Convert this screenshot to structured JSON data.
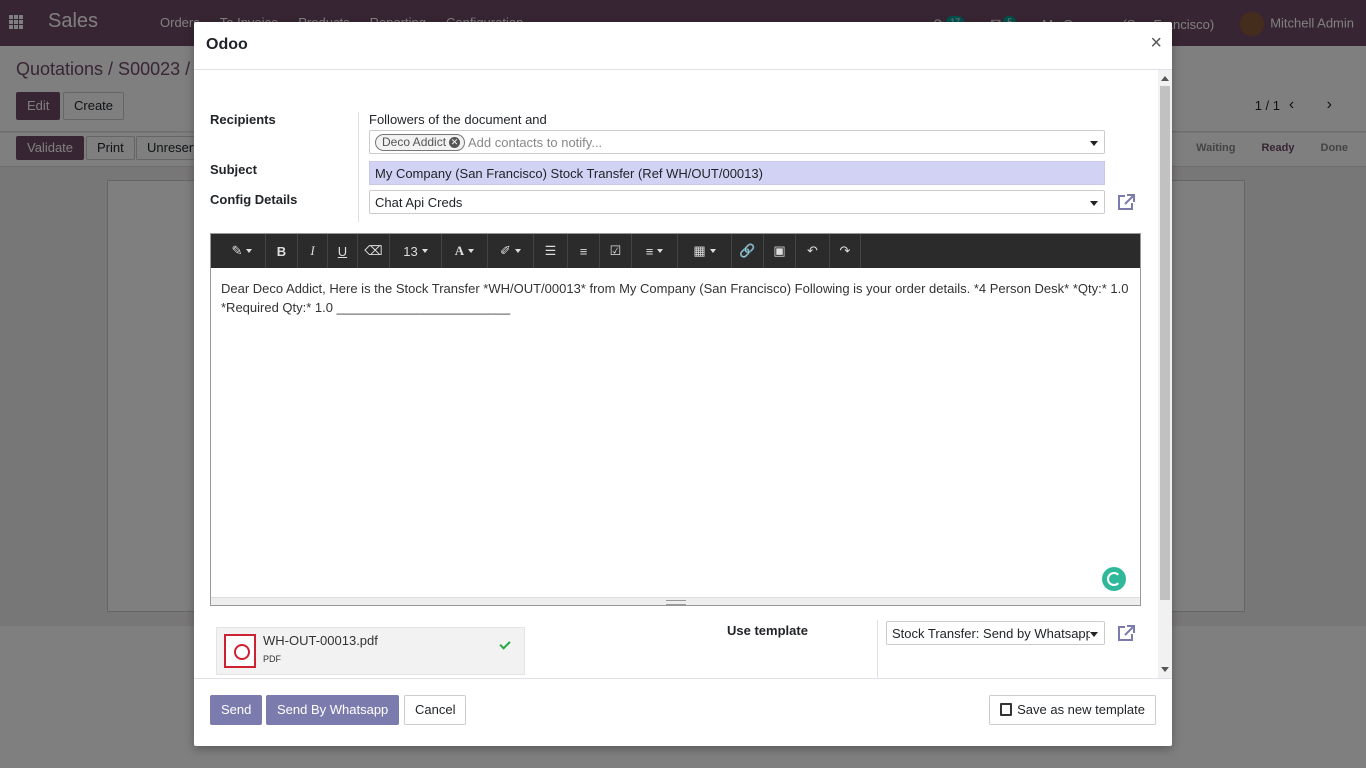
{
  "app": {
    "brand": "Sales",
    "menu": [
      "Orders",
      "To Invoice",
      "Products",
      "Reporting",
      "Configuration"
    ],
    "activity_count": "17",
    "message_count": "5",
    "company": "My Company (San Francisco)",
    "user": "Mitchell Admin",
    "breadcrumb": "Quotations / S00023 /",
    "edit_label": "Edit",
    "create_label": "Create",
    "pager": "1 / 1",
    "action_buttons": [
      "Validate",
      "Print",
      "Unreserve"
    ],
    "status_steps": [
      "Waiting",
      "Ready",
      "Done"
    ]
  },
  "modal": {
    "title": "Odoo",
    "close_glyph": "×",
    "recipients": {
      "label": "Recipients",
      "caption": "Followers of the document and",
      "tag": "Deco Addict",
      "placeholder": "Add contacts to notify..."
    },
    "subject": {
      "label": "Subject",
      "value": "My Company (San Francisco) Stock Transfer (Ref WH/OUT/00013)"
    },
    "config": {
      "label": "Config Details",
      "value": "Chat Api Creds"
    },
    "toolbar": {
      "font_size": "13"
    },
    "body_text": "Dear Deco Addict, Here is the Stock Transfer *WH/OUT/00013* from My Company (San Francisco) Following is your order details. *4 Person Desk* *Qty:* 1.0 *Required Qty:* 1.0 ________________________",
    "attachment": {
      "filename": "WH-OUT-00013.pdf",
      "type": "PDF"
    },
    "template": {
      "label": "Use template",
      "value": "Stock Transfer: Send by Whatsapp"
    },
    "footer": {
      "send": "Send",
      "send_whatsapp": "Send By Whatsapp",
      "cancel": "Cancel",
      "save_template": "Save as new template"
    }
  },
  "colors": {
    "brand": "#714b67",
    "primary_button": "#7c7bad",
    "subject_highlight": "#d2d2f4"
  }
}
